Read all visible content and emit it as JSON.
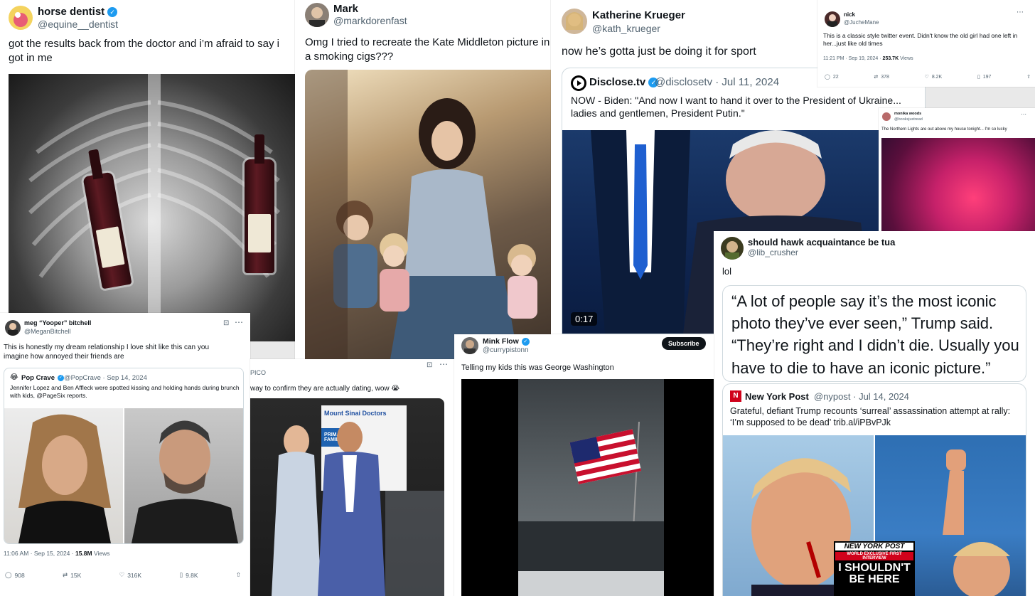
{
  "tweet1": {
    "name": "horse dentist",
    "handle": "@equine__dentist",
    "text": "got the results back from the doctor and i’m afraid to say i got in me",
    "image_desc_icon": "xray-image"
  },
  "tweet2": {
    "name": "Mark",
    "handle": "@markdorenfast",
    "text": "Omg I tried to recreate the Kate Middleton picture in a smoking cigs???"
  },
  "tweet3": {
    "name": "Katherine Krueger",
    "handle": "@kath_krueger",
    "text": "now he’s gotta just be doing it for sport",
    "quote": {
      "name": "Disclose.tv",
      "handle": "@disclosetv",
      "date": "· Jul 11, 2024",
      "text": "NOW - Biden: \"And now I want to hand it over to the President of Ukraine... ladies and gentlemen, President Putin.\"",
      "duration": "0:17"
    }
  },
  "tweet4": {
    "name": "nick",
    "handle": "@JucheMane",
    "text": "This is a classic style twitter event. Didn't know the old girl had one left in her...just like old times",
    "time": "11:21 PM · Sep 19, 2024 ·",
    "views_count": "253.7K",
    "views_label": "Views",
    "replies": "22",
    "retweets": "378",
    "likes": "8.2K",
    "bookmarks": "197"
  },
  "tweet5": {
    "name": "monika woods",
    "handle": "@booksjustread",
    "text": "The Northern Lights are out above my house tonight... I'm so lucky"
  },
  "tweet6": {
    "name": "should hawk acquaintance be tua",
    "handle": "@lib_crusher",
    "text": "lol",
    "quote_big": "“A lot of people say it’s the most iconic photo they’ve ever seen,” Trump said. “They’re right and I didn’t die. Usually you have to die to have an iconic picture.”",
    "nested": {
      "name": "New York Post",
      "handle": "@nypost",
      "date": "· Jul 14, 2024",
      "text": "Grateful, defiant Trump recounts ‘surreal’ assassination attempt at rally: ‘I’m supposed to be dead’ trib.al/iPBvPJk",
      "cover_masthead": "NEW YORK POST",
      "cover_sub": "WORLD EXCLUSIVE FIRST INTERVIEW",
      "cover_headline": "I SHOULDN'T BE HERE"
    }
  },
  "tweet7": {
    "name": "meg “Yooper” bitchell",
    "handle": "@MeganBitchell",
    "text": "This is honestly my dream relationship I love shit like this can you imagine how annoyed their friends are",
    "quote": {
      "name": "Pop Crave",
      "handle": "@PopCrave",
      "date": "· Sep 14, 2024",
      "text": "Jennifer Lopez and Ben Affleck were spotted kissing and holding hands during brunch with kids, @PageSix reports."
    },
    "time": "11:06 AM · Sep 15, 2024 ·",
    "views_count": "15.8M",
    "views_label": "Views",
    "replies": "908",
    "retweets": "15K",
    "likes": "316K",
    "bookmarks": "9.8K"
  },
  "tweet8": {
    "handle_fragment": "PICO",
    "text": "way to confirm they are actually dating, wow 😭",
    "sign_text": "Mount Sinai Doctors",
    "sign_text2": "PRIMARY FAMILY M"
  },
  "tweet9": {
    "name": "Mink Flow",
    "handle": "@currypistonn",
    "text": "Telling my kids this was George Washington",
    "subscribe": "Subscribe"
  },
  "colors": {
    "accent": "#1d9bf0",
    "text": "#0f1419",
    "muted": "#536471",
    "nypost_red": "#d0021b"
  }
}
